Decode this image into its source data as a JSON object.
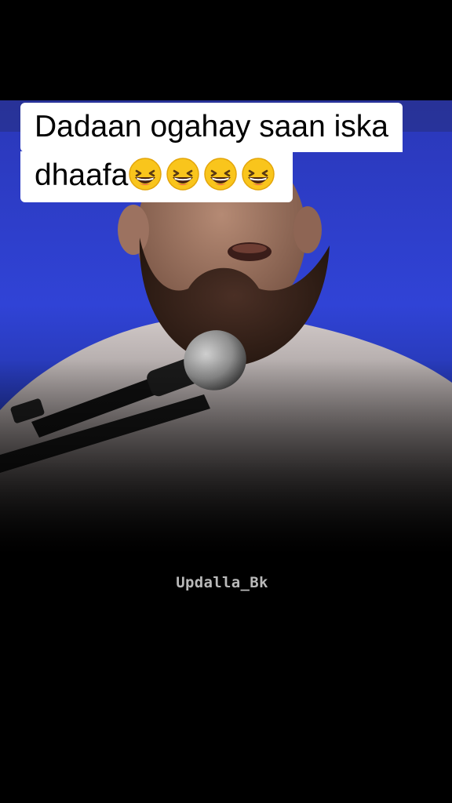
{
  "video": {
    "caption_line_1": "Dadaan ogahay saan iska",
    "caption_line_2": "dhaafa",
    "caption_emoji": [
      "grinning-squinting-face-emoji",
      "grinning-squinting-face-emoji",
      "grinning-squinting-face-emoji",
      "grinning-squinting-face-emoji"
    ],
    "watermark": "Updalla_Bk"
  },
  "colors": {
    "background": "#000000",
    "backdrop_blue": "#2c3fd3",
    "caption_bg": "#ffffff",
    "caption_text": "#000000",
    "watermark": "#b9b9b9"
  }
}
